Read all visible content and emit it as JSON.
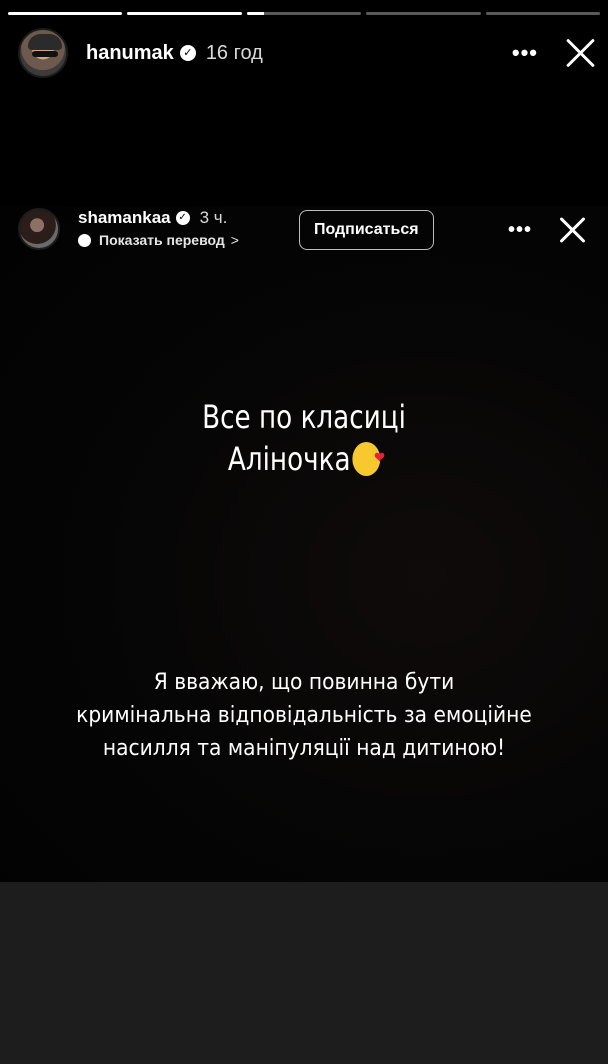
{
  "progress": [
    {
      "fill": 1.0
    },
    {
      "fill": 1.0
    },
    {
      "fill": 0.15
    },
    {
      "fill": 0.0
    },
    {
      "fill": 0.0
    }
  ],
  "outer": {
    "username": "hanumak",
    "time": "16 год"
  },
  "shared": {
    "username": "shamankaa",
    "time": "3 ч.",
    "translate_label": "Показать перевод",
    "follow_label": "Подписаться"
  },
  "content": {
    "title_line1": "Все по класиці",
    "title_line2": "Аліночка",
    "body_line1": "Я вважаю, що повинна бути",
    "body_line2": "кримінальна відповідальність за емоційне",
    "body_line3": "насилля та маніпуляції над дитиною!"
  },
  "icons": {
    "verified": "verified-badge-icon",
    "more": "more-dots-icon",
    "close": "close-icon",
    "globe": "globe-icon",
    "emoji": "kissing-face-emoji"
  },
  "colors": {
    "background": "#000000",
    "bottom": "#1d1d1d",
    "text": "#ffffff"
  }
}
